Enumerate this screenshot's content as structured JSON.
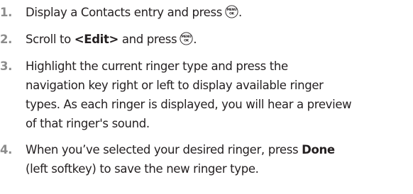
{
  "steps": [
    {
      "number": "1.",
      "line1_text": "Display a Contacts entry and press",
      "line1_after": "."
    },
    {
      "number": "2.",
      "line1_prefix": "Scroll to ",
      "line1_bold": "<Edit>",
      "line1_text": " and press",
      "line1_after": "."
    },
    {
      "number": "3.",
      "lines": [
        "Highlight the current ringer type and press the",
        "navigation key right or left to display available ringer",
        "types. As each ringer is displayed, you will hear a preview",
        "of that ringer's sound."
      ]
    },
    {
      "number": "4.",
      "line1_text": "When you’ve selected your desired ringer, press ",
      "line1_bold": "Done",
      "line2_text": "(left softkey) to save the new ringer type."
    }
  ],
  "menu_key_icon": {
    "name": "menu-ok-key-icon",
    "top_label": "MENU",
    "bottom_label": "OK"
  },
  "colors": {
    "text": "#231f20",
    "step_number": "#8c8c8c"
  }
}
